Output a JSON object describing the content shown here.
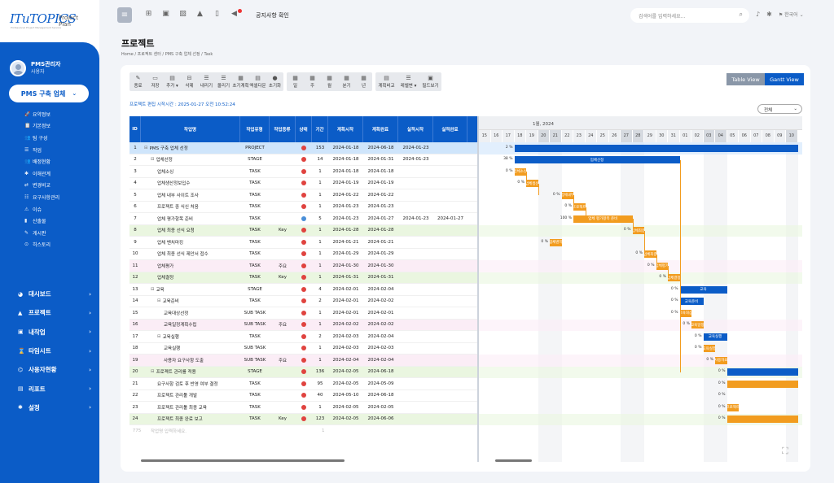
{
  "logo": {
    "main": "ITuTOPICS",
    "sub1": "Project",
    "sub2": "Plan",
    "tag": "Professional Project Management Service"
  },
  "user": {
    "name": "PMS관리자",
    "role": "사용자"
  },
  "project_select": {
    "label": "PMS 구축 업체"
  },
  "subnav": [
    {
      "icon": "🚀",
      "label": "요약정보"
    },
    {
      "icon": "📋",
      "label": "기본정보"
    },
    {
      "icon": "👥",
      "label": "팀 구성"
    },
    {
      "icon": "☰",
      "label": "작업"
    },
    {
      "icon": "👥",
      "label": "배정현황"
    },
    {
      "icon": "✱",
      "label": "이해관계"
    },
    {
      "icon": "⇄",
      "label": "변경비교"
    },
    {
      "icon": "☷",
      "label": "요구사항관리"
    },
    {
      "icon": "⚠",
      "label": "이슈"
    },
    {
      "icon": "▮",
      "label": "산출물"
    },
    {
      "icon": "✎",
      "label": "게시판"
    },
    {
      "icon": "⊙",
      "label": "히스토리"
    }
  ],
  "mainnav": [
    {
      "icon": "◕",
      "label": "대시보드"
    },
    {
      "icon": "▲",
      "label": "프로젝트"
    },
    {
      "icon": "▣",
      "label": "내작업"
    },
    {
      "icon": "⌛",
      "label": "타임시트"
    },
    {
      "icon": "⌬",
      "label": "사용자현황"
    },
    {
      "icon": "▤",
      "label": "리포트"
    },
    {
      "icon": "✱",
      "label": "설정"
    }
  ],
  "topbar": {
    "notice": "공지사항 확인",
    "search_placeholder": "검색어를 입력하세요...",
    "lang": "한국어"
  },
  "page": {
    "title": "프로젝트",
    "breadcrumb": [
      "Home",
      "프로젝트 센터",
      "PMS 구축 업체 선정",
      "Task"
    ]
  },
  "toolbar_groups": [
    [
      {
        "icon": "✎",
        "label": "종료"
      },
      {
        "icon": "▭",
        "label": "저장"
      },
      {
        "icon": "▤",
        "label": "추가 ▾"
      },
      {
        "icon": "⊟",
        "label": "삭제"
      },
      {
        "icon": "☰",
        "label": "내리기"
      },
      {
        "icon": "☰",
        "label": "올리기"
      },
      {
        "icon": "▦",
        "label": "초기계획"
      },
      {
        "icon": "▤",
        "label": "엑셀다운"
      },
      {
        "icon": "●",
        "label": "초기화"
      }
    ],
    [
      {
        "icon": "▦",
        "label": "일"
      },
      {
        "icon": "▦",
        "label": "주"
      },
      {
        "icon": "▦",
        "label": "월"
      },
      {
        "icon": "▦",
        "label": "분기"
      },
      {
        "icon": "▦",
        "label": "년"
      }
    ],
    [
      {
        "icon": "▤",
        "label": "계획비교"
      },
      {
        "icon": "☰",
        "label": "레벨변 ▾"
      },
      {
        "icon": "▣",
        "label": "필드보기"
      }
    ]
  ],
  "views": {
    "table": "Table View",
    "gantt": "Gantt View"
  },
  "info": "프로젝트 편집 시작시간 : 2025-01-27 오전 10:52:24",
  "filter": {
    "value": "전체"
  },
  "colors": {
    "brand": "#0b5cc7",
    "bar_orange": "#f29c1f",
    "status_red": "#e0433f",
    "status_blue": "#4a8fd8",
    "select_row": "#cfe5fb",
    "tint_green": "#eaf6e0",
    "tint_pink": "#fbedf6"
  },
  "grid": {
    "headers": [
      "ID",
      "작업명",
      "작업유형",
      "작업종류",
      "상태",
      "기간",
      "계획시작",
      "계획완료",
      "실적시작",
      "실적완료"
    ],
    "rows": [
      {
        "id": "1",
        "name": "PMS 구축 업체 선정",
        "indent": 0,
        "tog": "⊟",
        "type": "PROJECT",
        "kind": "",
        "status": "red",
        "dur": "153",
        "ps": "2024-01-18",
        "pe": "2024-06-18",
        "as": "2024-01-23",
        "ae": "",
        "tint": "select"
      },
      {
        "id": "2",
        "name": "업체선정",
        "indent": 1,
        "tog": "⊟",
        "type": "STAGE",
        "kind": "",
        "status": "red",
        "dur": "14",
        "ps": "2024-01-18",
        "pe": "2024-01-31",
        "as": "2024-01-23",
        "ae": "",
        "tint": ""
      },
      {
        "id": "3",
        "name": "업체소싱",
        "indent": 2,
        "tog": "",
        "type": "TASK",
        "kind": "",
        "status": "red",
        "dur": "1",
        "ps": "2024-01-18",
        "pe": "2024-01-18",
        "as": "",
        "ae": "",
        "tint": ""
      },
      {
        "id": "4",
        "name": "업체생산정보입수",
        "indent": 2,
        "tog": "",
        "type": "TASK",
        "kind": "",
        "status": "red",
        "dur": "1",
        "ps": "2024-01-19",
        "pe": "2024-01-19",
        "as": "",
        "ae": "",
        "tint": ""
      },
      {
        "id": "5",
        "name": "업체 내부 사이트 조사",
        "indent": 2,
        "tog": "",
        "type": "TASK",
        "kind": "",
        "status": "red",
        "dur": "1",
        "ps": "2024-01-22",
        "pe": "2024-01-22",
        "as": "",
        "ae": "",
        "tint": ""
      },
      {
        "id": "6",
        "name": "프로젝트 중 식신 처음",
        "indent": 2,
        "tog": "",
        "type": "TASK",
        "kind": "",
        "status": "red",
        "dur": "1",
        "ps": "2024-01-23",
        "pe": "2024-01-23",
        "as": "",
        "ae": "",
        "tint": ""
      },
      {
        "id": "7",
        "name": "업체 평가항목 준비",
        "indent": 2,
        "tog": "",
        "type": "TASK",
        "kind": "",
        "status": "blue",
        "dur": "5",
        "ps": "2024-01-23",
        "pe": "2024-01-27",
        "as": "2024-01-23",
        "ae": "2024-01-27",
        "tint": ""
      },
      {
        "id": "8",
        "name": "업체 최종 선식 요청",
        "indent": 2,
        "tog": "",
        "type": "TASK",
        "kind": "Key",
        "status": "red",
        "dur": "1",
        "ps": "2024-01-28",
        "pe": "2024-01-28",
        "as": "",
        "ae": "",
        "tint": "green"
      },
      {
        "id": "9",
        "name": "업체 벤치마킹",
        "indent": 2,
        "tog": "",
        "type": "TASK",
        "kind": "",
        "status": "red",
        "dur": "1",
        "ps": "2024-01-21",
        "pe": "2024-01-21",
        "as": "",
        "ae": "",
        "tint": ""
      },
      {
        "id": "10",
        "name": "업체 최종 선식 제안서 접수",
        "indent": 2,
        "tog": "",
        "type": "TASK",
        "kind": "",
        "status": "red",
        "dur": "1",
        "ps": "2024-01-29",
        "pe": "2024-01-29",
        "as": "",
        "ae": "",
        "tint": ""
      },
      {
        "id": "11",
        "name": "업체평가",
        "indent": 2,
        "tog": "",
        "type": "TASK",
        "kind": "주요",
        "status": "red",
        "dur": "1",
        "ps": "2024-01-30",
        "pe": "2024-01-30",
        "as": "",
        "ae": "",
        "tint": "pink"
      },
      {
        "id": "12",
        "name": "업체결정",
        "indent": 2,
        "tog": "",
        "type": "TASK",
        "kind": "Key",
        "status": "red",
        "dur": "1",
        "ps": "2024-01-31",
        "pe": "2024-01-31",
        "as": "",
        "ae": "",
        "tint": "green"
      },
      {
        "id": "13",
        "name": "교육",
        "indent": 1,
        "tog": "⊟",
        "type": "STAGE",
        "kind": "",
        "status": "red",
        "dur": "4",
        "ps": "2024-02-01",
        "pe": "2024-02-04",
        "as": "",
        "ae": "",
        "tint": ""
      },
      {
        "id": "14",
        "name": "교육준비",
        "indent": 2,
        "tog": "⊟",
        "type": "TASK",
        "kind": "",
        "status": "red",
        "dur": "2",
        "ps": "2024-02-01",
        "pe": "2024-02-02",
        "as": "",
        "ae": "",
        "tint": ""
      },
      {
        "id": "15",
        "name": "교육대상선정",
        "indent": 3,
        "tog": "",
        "type": "SUB TASK",
        "kind": "",
        "status": "red",
        "dur": "1",
        "ps": "2024-02-01",
        "pe": "2024-02-01",
        "as": "",
        "ae": "",
        "tint": ""
      },
      {
        "id": "16",
        "name": "교육일정계획수립",
        "indent": 3,
        "tog": "",
        "type": "SUB TASK",
        "kind": "주요",
        "status": "red",
        "dur": "1",
        "ps": "2024-02-02",
        "pe": "2024-02-02",
        "as": "",
        "ae": "",
        "tint": "pink"
      },
      {
        "id": "17",
        "name": "교육실행",
        "indent": 2,
        "tog": "⊟",
        "type": "TASK",
        "kind": "",
        "status": "red",
        "dur": "2",
        "ps": "2024-02-03",
        "pe": "2024-02-04",
        "as": "",
        "ae": "",
        "tint": ""
      },
      {
        "id": "18",
        "name": "교육실행",
        "indent": 3,
        "tog": "",
        "type": "SUB TASK",
        "kind": "",
        "status": "red",
        "dur": "1",
        "ps": "2024-02-03",
        "pe": "2024-02-03",
        "as": "",
        "ae": "",
        "tint": ""
      },
      {
        "id": "19",
        "name": "사용자 요구사항 도출",
        "indent": 3,
        "tog": "",
        "type": "SUB TASK",
        "kind": "주요",
        "status": "red",
        "dur": "1",
        "ps": "2024-02-04",
        "pe": "2024-02-04",
        "as": "",
        "ae": "",
        "tint": "pink"
      },
      {
        "id": "20",
        "name": "프로젝트 관리를 적용",
        "indent": 1,
        "tog": "⊟",
        "type": "STAGE",
        "kind": "",
        "status": "red",
        "dur": "136",
        "ps": "2024-02-05",
        "pe": "2024-06-18",
        "as": "",
        "ae": "",
        "tint": "green"
      },
      {
        "id": "21",
        "name": "요구사항 검토 후 반영 여부 결정",
        "indent": 2,
        "tog": "",
        "type": "TASK",
        "kind": "",
        "status": "red",
        "dur": "95",
        "ps": "2024-02-05",
        "pe": "2024-05-09",
        "as": "",
        "ae": "",
        "tint": ""
      },
      {
        "id": "22",
        "name": "프로젝트 관리툴 개발",
        "indent": 2,
        "tog": "",
        "type": "TASK",
        "kind": "",
        "status": "red",
        "dur": "40",
        "ps": "2024-05-10",
        "pe": "2024-06-18",
        "as": "",
        "ae": "",
        "tint": ""
      },
      {
        "id": "23",
        "name": "프로젝트 관리툴 최종 교육",
        "indent": 2,
        "tog": "",
        "type": "TASK",
        "kind": "",
        "status": "red",
        "dur": "1",
        "ps": "2024-02-05",
        "pe": "2024-02-05",
        "as": "",
        "ae": "",
        "tint": ""
      },
      {
        "id": "24",
        "name": "프로젝트 최종 완료 보고",
        "indent": 2,
        "tog": "",
        "type": "TASK",
        "kind": "Key",
        "status": "red",
        "dur": "123",
        "ps": "2024-02-05",
        "pe": "2024-06-06",
        "as": "",
        "ae": "",
        "tint": "green"
      }
    ],
    "add_row_id": "775",
    "add_row_placeholder": "작업명 입력하세요.",
    "add_row_dur": "1"
  },
  "gantt": {
    "month": "1월, 2024",
    "days": [
      "15",
      "16",
      "17",
      "18",
      "19",
      "20",
      "21",
      "22",
      "23",
      "24",
      "25",
      "26",
      "27",
      "28",
      "29",
      "30",
      "31",
      "01",
      "02",
      "03",
      "04",
      "05",
      "06",
      "07",
      "08",
      "09",
      "10"
    ],
    "weekend_days": [
      "20",
      "21",
      "27",
      "28",
      "03",
      "04",
      "10"
    ],
    "bars": [
      {
        "row": 0,
        "start": 3,
        "span": 24,
        "label": "",
        "kind": "summary",
        "pct": "2 %"
      },
      {
        "row": 1,
        "start": 3,
        "span": 14,
        "label": "업체선정",
        "kind": "summary",
        "pct": "38 %"
      },
      {
        "row": 2,
        "start": 3,
        "span": 1,
        "label": "업체소싱",
        "kind": "task",
        "pct": "0 %"
      },
      {
        "row": 3,
        "start": 4,
        "span": 1,
        "label": "업체생산",
        "kind": "task",
        "pct": "0 %"
      },
      {
        "row": 4,
        "start": 7,
        "span": 1,
        "label": "업체내부",
        "kind": "task",
        "pct": "0 %"
      },
      {
        "row": 5,
        "start": 8,
        "span": 1,
        "label": "프로젝트",
        "kind": "task",
        "pct": "0 %"
      },
      {
        "row": 6,
        "start": 8,
        "span": 5,
        "label": "업체 평가항목 준비",
        "kind": "task",
        "pct": "100 %"
      },
      {
        "row": 7,
        "start": 13,
        "span": 1,
        "label": "업체최종",
        "kind": "task",
        "pct": "0 %"
      },
      {
        "row": 8,
        "start": 6,
        "span": 1,
        "label": "업체벤치",
        "kind": "task",
        "pct": "0 %"
      },
      {
        "row": 9,
        "start": 14,
        "span": 1,
        "label": "업체최종",
        "kind": "task",
        "pct": "0 %"
      },
      {
        "row": 10,
        "start": 15,
        "span": 1,
        "label": "업체평가",
        "kind": "task",
        "pct": "0 %"
      },
      {
        "row": 11,
        "start": 16,
        "span": 1,
        "label": "업체결정",
        "kind": "task",
        "pct": "0 %"
      },
      {
        "row": 12,
        "start": 17,
        "span": 4,
        "label": "교육",
        "kind": "summary",
        "pct": "0 %"
      },
      {
        "row": 13,
        "start": 17,
        "span": 2,
        "label": "교육준비",
        "kind": "summary",
        "pct": "0 %"
      },
      {
        "row": 14,
        "start": 17,
        "span": 1,
        "label": "교육대상",
        "kind": "task",
        "pct": "0 %"
      },
      {
        "row": 15,
        "start": 18,
        "span": 1,
        "label": "교육일정",
        "kind": "task",
        "pct": "0 %"
      },
      {
        "row": 16,
        "start": 19,
        "span": 2,
        "label": "교육실행",
        "kind": "summary",
        "pct": "0 %"
      },
      {
        "row": 17,
        "start": 19,
        "span": 1,
        "label": "교육실행",
        "kind": "task",
        "pct": "0 %"
      },
      {
        "row": 18,
        "start": 20,
        "span": 1,
        "label": "사용자요",
        "kind": "task",
        "pct": "0 %"
      },
      {
        "row": 19,
        "start": 21,
        "span": 6,
        "label": "",
        "kind": "summary",
        "pct": "0 %"
      },
      {
        "row": 20,
        "start": 21,
        "span": 6,
        "label": "",
        "kind": "task",
        "pct": "0 %"
      },
      {
        "row": 21,
        "start": 21,
        "span": 0,
        "label": "",
        "kind": "task",
        "pct": "0 %"
      },
      {
        "row": 22,
        "start": 21,
        "span": 1,
        "label": "프로젝트",
        "kind": "task",
        "pct": "0 %"
      },
      {
        "row": 23,
        "start": 21,
        "span": 6,
        "label": "",
        "kind": "task",
        "pct": "0 %"
      }
    ]
  }
}
